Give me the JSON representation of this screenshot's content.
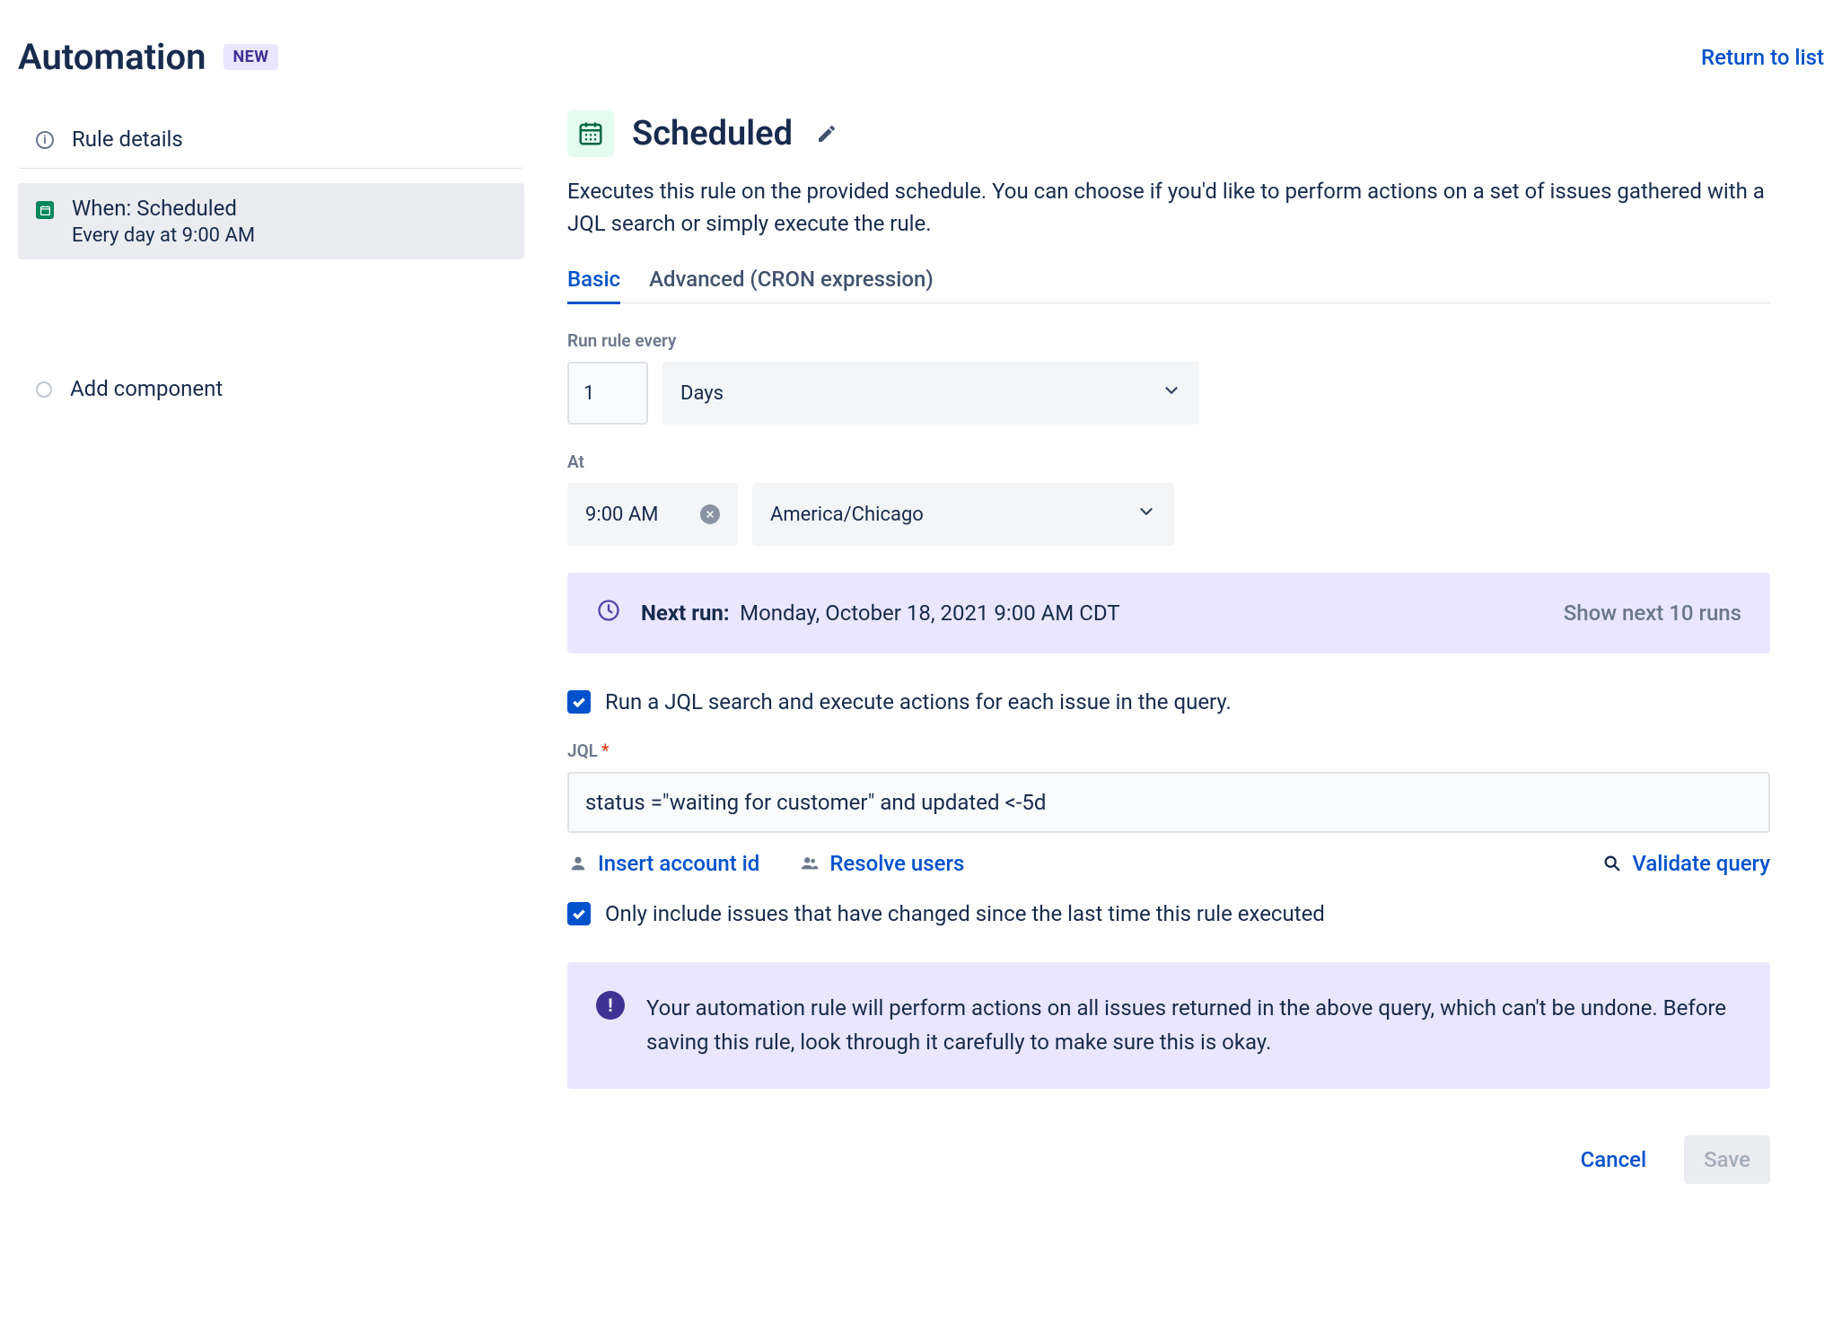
{
  "header": {
    "title": "Automation",
    "badge": "NEW",
    "return_link": "Return to list"
  },
  "sidebar": {
    "rule_details": "Rule details",
    "trigger_title": "When: Scheduled",
    "trigger_subtitle": "Every day at 9:00 AM",
    "add_component": "Add component"
  },
  "main": {
    "title": "Scheduled",
    "description": "Executes this rule on the provided schedule. You can choose if you'd like to perform actions on a set of issues gathered with a JQL search or simply execute the rule.",
    "tabs": {
      "basic": "Basic",
      "advanced": "Advanced (CRON expression)"
    },
    "schedule": {
      "run_label": "Run rule every",
      "interval_value": "1",
      "interval_unit": "Days",
      "at_label": "At",
      "time_value": "9:00 AM",
      "timezone": "America/Chicago"
    },
    "next_run": {
      "label": "Next run:",
      "value": "Monday, October 18, 2021 9:00 AM CDT",
      "show_next": "Show next 10 runs"
    },
    "jql_checkbox_label": "Run a JQL search and execute actions for each issue in the query.",
    "jql": {
      "label": "JQL",
      "value": "status =\"waiting for customer\" and updated <-5d",
      "insert_account": "Insert account id",
      "resolve_users": "Resolve users",
      "validate": "Validate query"
    },
    "only_changed_label": "Only include issues that have changed since the last time this rule executed",
    "info_text": "Your automation rule will perform actions on all issues returned in the above query, which can't be undone. Before saving this rule, look through it carefully to make sure this is okay."
  },
  "footer": {
    "cancel": "Cancel",
    "save": "Save"
  }
}
